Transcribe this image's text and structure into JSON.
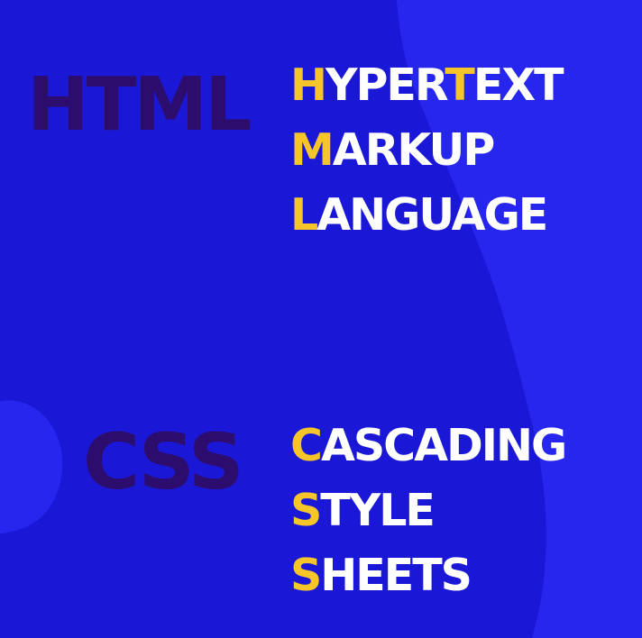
{
  "colors": {
    "background": "#1a18d6",
    "shape": "#2626ee",
    "acronym": "#2c0d6e",
    "text": "#ffffff",
    "highlight": "#f5c52a"
  },
  "html_block": {
    "acronym": "HTML",
    "lines": [
      {
        "parts": [
          {
            "text": "H",
            "highlight": true
          },
          {
            "text": "YPER",
            "highlight": false
          },
          {
            "text": "T",
            "highlight": true
          },
          {
            "text": "EXT",
            "highlight": false
          }
        ]
      },
      {
        "parts": [
          {
            "text": "M",
            "highlight": true
          },
          {
            "text": "ARKUP",
            "highlight": false
          }
        ]
      },
      {
        "parts": [
          {
            "text": "L",
            "highlight": true
          },
          {
            "text": "ANGUAGE",
            "highlight": false
          }
        ]
      }
    ]
  },
  "css_block": {
    "acronym": "CSS",
    "lines": [
      {
        "parts": [
          {
            "text": "C",
            "highlight": true
          },
          {
            "text": "ASCADING",
            "highlight": false
          }
        ]
      },
      {
        "parts": [
          {
            "text": "S",
            "highlight": true
          },
          {
            "text": "TYLE",
            "highlight": false
          }
        ]
      },
      {
        "parts": [
          {
            "text": "S",
            "highlight": true
          },
          {
            "text": "HEETS",
            "highlight": false
          }
        ]
      }
    ]
  }
}
